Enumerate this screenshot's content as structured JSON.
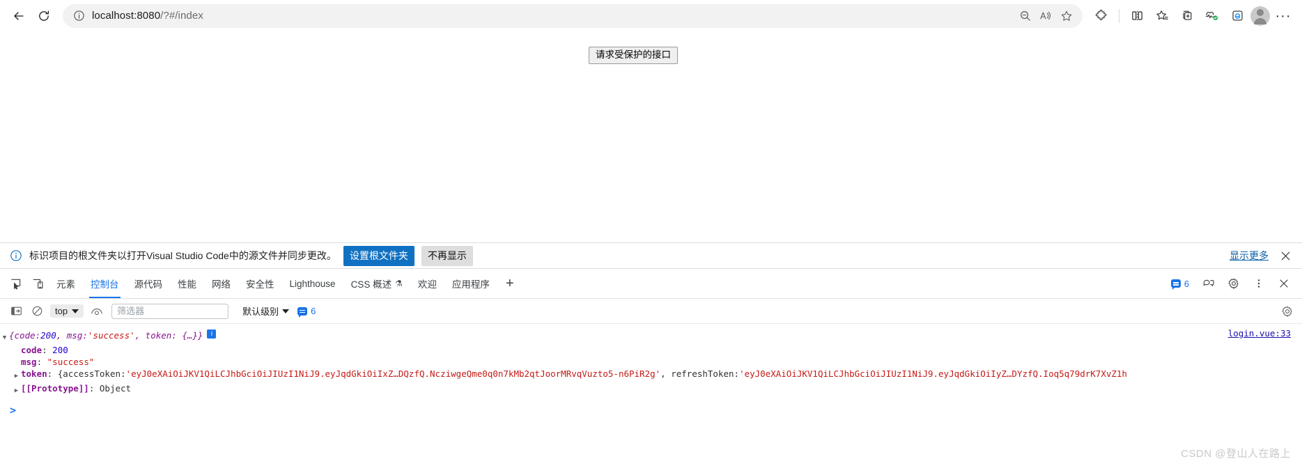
{
  "browser": {
    "back_label": "Back",
    "refresh_label": "Refresh",
    "url_host": "localhost:8080",
    "url_path": "/?#/index",
    "url_full": "localhost:8080/?#/index",
    "icons": {
      "site_info": "info-circle-icon",
      "zoom": "zoom-out-icon",
      "read_aloud": "read-aloud-icon",
      "favorite": "star-icon",
      "extensions": "extensions-puzzle-icon",
      "split_screen": "split-screen-icon",
      "collections_star": "favorites-list-icon",
      "collections": "collections-icon",
      "browser_essentials": "browser-essentials-heart-icon",
      "ie_mode": "internet-explorer-icon",
      "profile": "profile-avatar-icon",
      "settings_more": "more-options-icon"
    }
  },
  "page": {
    "button_label": "请求受保护的接口"
  },
  "infobar": {
    "icon": "info-circle-icon",
    "message": "标识项目的根文件夹以打开Visual Studio Code中的源文件并同步更改。",
    "primary_button": "设置根文件夹",
    "secondary_button": "不再显示",
    "more_link": "显示更多",
    "close_label": "×",
    "accent": "#1071c2"
  },
  "devtools": {
    "tabs": [
      {
        "label": "元素",
        "active": false
      },
      {
        "label": "控制台",
        "active": true
      },
      {
        "label": "源代码",
        "active": false
      },
      {
        "label": "性能",
        "active": false
      },
      {
        "label": "网络",
        "active": false
      },
      {
        "label": "安全性",
        "active": false
      },
      {
        "label": "Lighthouse",
        "active": false
      },
      {
        "label": "CSS 概述",
        "active": false,
        "badge": "⚗"
      },
      {
        "label": "欢迎",
        "active": false
      },
      {
        "label": "应用程序",
        "active": false
      }
    ],
    "add_tab_label": "+",
    "message_count": "6",
    "right_icons": {
      "feedback": "feedback-icon",
      "settings": "gear-icon",
      "more": "more-vertical-icon",
      "close": "close-icon"
    },
    "toolbar": {
      "sidebar_toggle": "console-sidebar-icon",
      "clear_console": "clear-console-icon",
      "context": "top",
      "eye_icon": "live-expression-eye-icon",
      "filter_placeholder": "筛选器",
      "filter_value": "",
      "level": "默认级别",
      "issue_count": "6",
      "settings_icon": "gear-icon"
    },
    "accent": "#1a73e8"
  },
  "console": {
    "source_link": "login.vue:33",
    "entry": {
      "summary_prefix": "{code: ",
      "summary_code": "200",
      "summary_mid": ", msg: ",
      "summary_msg": "'success'",
      "summary_suffix": ", token: {…}}",
      "badge": "i",
      "props": [
        {
          "key": "code",
          "value": "200",
          "type": "number"
        },
        {
          "key": "msg",
          "value": "\"success\"",
          "type": "string"
        }
      ],
      "token_key": "token",
      "token_value_1": "{accessToken: ",
      "access_token": "'eyJ0eXAiOiJKV1QiLCJhbGciOiJIUzI1NiJ9.eyJqdGkiOiIxZ…DQzfQ.NcziwgeQme0q0n7kMb2qtJoorMRvqVuzto5-n6PiR2g'",
      "token_sep": ", refreshToken: ",
      "refresh_token": "'eyJ0eXAiOiJKV1QiLCJhbGciOiJIUzI1NiJ9.eyJqdGkiOiIyZ…DYzfQ.Ioq5q79drK7XvZ1h",
      "prototype_key": "[[Prototype]]",
      "prototype_value": "Object"
    },
    "prompt": ">",
    "watermark": "CSDN @登山人在路上"
  }
}
